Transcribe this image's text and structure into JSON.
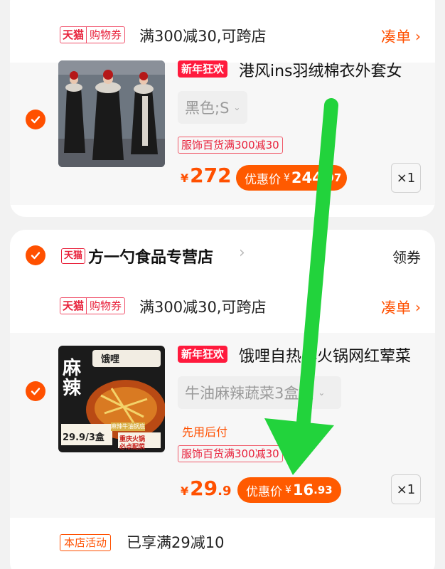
{
  "colors": {
    "accent": "#ff5000",
    "tmall_red": "#e8213b",
    "annotation_green": "#22d33c"
  },
  "card1": {
    "promo": {
      "tmall": "天猫",
      "shopping_coupon": "购物券",
      "text": "满300减30,可跨店",
      "coudan": "凑单"
    },
    "item": {
      "badge": "新年狂欢",
      "title": "港风ins羽绒棉衣外套女",
      "sku": "黑色;S",
      "tag": "服饰百货满300减30",
      "price_cur": "¥",
      "price_int": "272",
      "price_dec": "",
      "promo_label": "优惠价",
      "promo_cur": "¥",
      "promo_int": "244",
      "promo_dec": ".97",
      "qty": "×1"
    }
  },
  "card2": {
    "shop": {
      "logo": "天猫",
      "name": "方一勺食品专营店",
      "lingquan": "领券"
    },
    "promo": {
      "tmall": "天猫",
      "shopping_coupon": "购物券",
      "text": "满300减30,可跨店",
      "coudan": "凑单"
    },
    "item": {
      "badge": "新年狂欢",
      "title": "饿哩自热小火锅网红荤菜",
      "sku": "牛油麻辣蔬菜3盒装",
      "pay_later": "先用后付",
      "tag": "服饰百货满300减30",
      "price_cur": "¥",
      "price_int": "29",
      "price_dec": ".9",
      "promo_label": "优惠价",
      "promo_cur": "¥",
      "promo_int": "16",
      "promo_dec": ".93",
      "qty": "×1",
      "img_text": {
        "big": "麻辣",
        "brand": "饿哩",
        "price": "29.9/3盒",
        "sub1": "麻辣牛油锅底",
        "sub2": "重庆火锅",
        "sub3": "必点配菜"
      }
    },
    "activity": {
      "tag": "本店活动",
      "text": "已享满29减10"
    }
  }
}
